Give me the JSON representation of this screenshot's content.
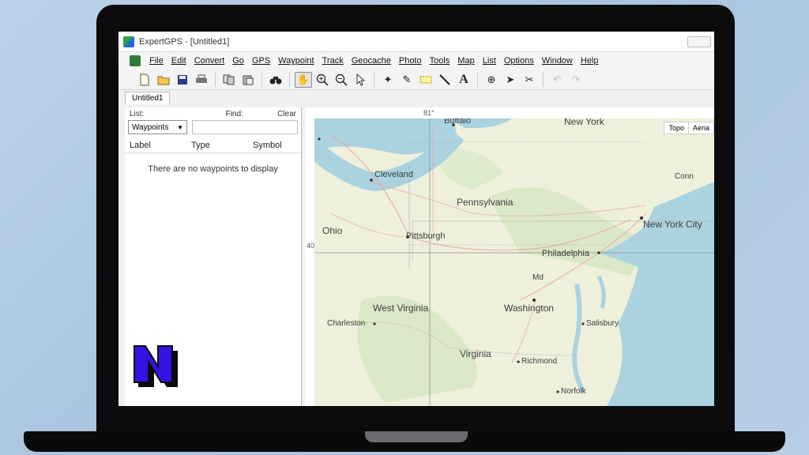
{
  "window": {
    "title": "ExpertGPS - [Untitled1]"
  },
  "menubar": {
    "items": [
      "File",
      "Edit",
      "Convert",
      "Go",
      "GPS",
      "Waypoint",
      "Track",
      "Geocache",
      "Photo",
      "Tools",
      "Map",
      "List",
      "Options",
      "Window",
      "Help"
    ]
  },
  "toolbar": {
    "icons": [
      "new-file-icon",
      "open-folder-icon",
      "save-icon",
      "print-icon",
      "copy-icon",
      "paste-icon",
      "binoculars-icon",
      "hand-pan-icon",
      "zoom-in-icon",
      "zoom-out-icon",
      "pointer-icon",
      "add-waypoint-icon",
      "pencil-icon",
      "rectangle-select-icon",
      "line-tool-icon",
      "text-tool-icon",
      "crosshair-icon",
      "route-icon",
      "scissors-icon",
      "undo-icon",
      "redo-icon"
    ]
  },
  "tabs": {
    "doc": "Untitled1"
  },
  "left_panel": {
    "list_label": "List:",
    "find_label": "Find:",
    "clear_label": "Clear",
    "list_value": "Waypoints",
    "find_value": "",
    "columns": [
      "Label",
      "Type",
      "Symbol"
    ],
    "empty_message": "There are no waypoints to display"
  },
  "map": {
    "toggle": {
      "topo": "Topo",
      "aerial": "Aeria"
    },
    "lat_label": "81°",
    "lon_label": "40°",
    "labels": {
      "buffalo": "Buffalo",
      "new_york": "New York",
      "cleveland": "Cleveland",
      "pennsylvania": "Pennsylvania",
      "ohio": "Ohio",
      "pittsburgh": "Pittsburgh",
      "new_york_city": "New York City",
      "philadelphia": "Philadelphia",
      "md": "Md",
      "west_virginia": "West Virginia",
      "washington": "Washington",
      "charleston": "Charleston",
      "salisbury": "Salisbury",
      "virginia": "Virginia",
      "richmond": "Richmond",
      "norfolk": "Norfolk",
      "conn": "Conn"
    },
    "colors": {
      "land": "#eef0dc",
      "water": "#aad3df",
      "forest": "#d6e6c2"
    }
  }
}
